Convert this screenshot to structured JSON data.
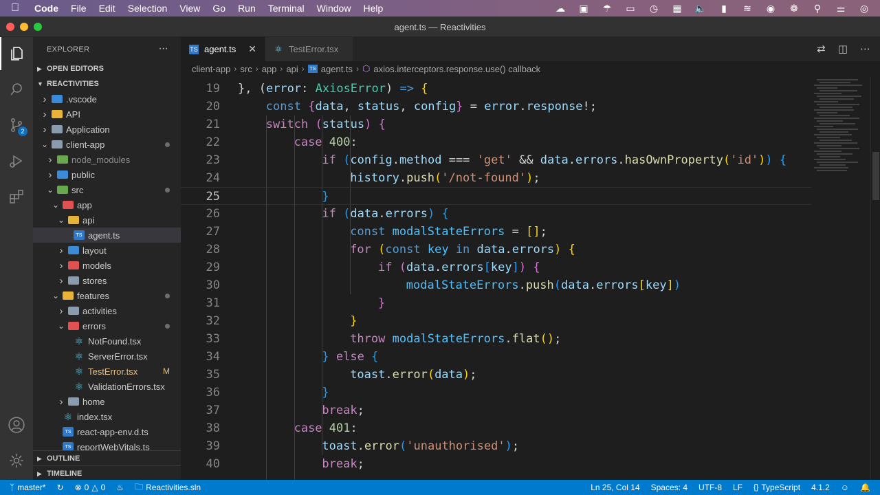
{
  "menubar": {
    "app": "Code",
    "items": [
      "File",
      "Edit",
      "Selection",
      "View",
      "Go",
      "Run",
      "Terminal",
      "Window",
      "Help"
    ]
  },
  "window": {
    "title": "agent.ts — Reactivities"
  },
  "activitybar": {
    "scm_badge": "2"
  },
  "sidebar": {
    "title": "EXPLORER",
    "open_editors": "OPEN EDITORS",
    "project": "REACTIVITIES",
    "tree": [
      {
        "label": ".vscode",
        "depth": 1,
        "kind": "folder",
        "open": false,
        "icon_color": "#3b8bd8"
      },
      {
        "label": "API",
        "depth": 1,
        "kind": "folder",
        "open": false,
        "icon_color": "#e8b339"
      },
      {
        "label": "Application",
        "depth": 1,
        "kind": "folder",
        "open": false,
        "icon_color": "#8a9bb0"
      },
      {
        "label": "client-app",
        "depth": 1,
        "kind": "folder",
        "open": true,
        "icon_color": "#8a9bb0",
        "dot": true
      },
      {
        "label": "node_modules",
        "depth": 2,
        "kind": "folder",
        "open": false,
        "icon_color": "#6aa84f",
        "dim": true
      },
      {
        "label": "public",
        "depth": 2,
        "kind": "folder",
        "open": false,
        "icon_color": "#3b8bd8"
      },
      {
        "label": "src",
        "depth": 2,
        "kind": "folder",
        "open": true,
        "icon_color": "#6aa84f",
        "dot": true
      },
      {
        "label": "app",
        "depth": 3,
        "kind": "folder",
        "open": true,
        "icon_color": "#e05252"
      },
      {
        "label": "api",
        "depth": 4,
        "kind": "folder",
        "open": true,
        "icon_color": "#e8b339"
      },
      {
        "label": "agent.ts",
        "depth": 5,
        "kind": "ts",
        "selected": true
      },
      {
        "label": "layout",
        "depth": 4,
        "kind": "folder",
        "open": false,
        "icon_color": "#3b8bd8"
      },
      {
        "label": "models",
        "depth": 4,
        "kind": "folder",
        "open": false,
        "icon_color": "#e05252"
      },
      {
        "label": "stores",
        "depth": 4,
        "kind": "folder",
        "open": false,
        "icon_color": "#8a9bb0"
      },
      {
        "label": "features",
        "depth": 3,
        "kind": "folder",
        "open": true,
        "icon_color": "#e8b339",
        "dot": true
      },
      {
        "label": "activities",
        "depth": 4,
        "kind": "folder",
        "open": false,
        "icon_color": "#8a9bb0"
      },
      {
        "label": "errors",
        "depth": 4,
        "kind": "folder",
        "open": true,
        "icon_color": "#e05252",
        "dot": true
      },
      {
        "label": "NotFound.tsx",
        "depth": 5,
        "kind": "react"
      },
      {
        "label": "ServerError.tsx",
        "depth": 5,
        "kind": "react"
      },
      {
        "label": "TestError.tsx",
        "depth": 5,
        "kind": "react",
        "modified": "M"
      },
      {
        "label": "ValidationErrors.tsx",
        "depth": 5,
        "kind": "react"
      },
      {
        "label": "home",
        "depth": 4,
        "kind": "folder",
        "open": false,
        "icon_color": "#8a9bb0"
      },
      {
        "label": "index.tsx",
        "depth": 3,
        "kind": "react"
      },
      {
        "label": "react-app-env.d.ts",
        "depth": 3,
        "kind": "ts"
      },
      {
        "label": "reportWebVitals.ts",
        "depth": 3,
        "kind": "ts"
      }
    ],
    "outline": "OUTLINE",
    "timeline": "TIMELINE"
  },
  "tabs": [
    {
      "label": "agent.ts",
      "active": true,
      "kind": "ts"
    },
    {
      "label": "TestError.tsx",
      "active": false,
      "kind": "react"
    }
  ],
  "breadcrumb": [
    "client-app",
    "src",
    "app",
    "api",
    "agent.ts",
    "axios.interceptors.response.use() callback"
  ],
  "editor": {
    "current_line": "25",
    "lines": [
      {
        "n": "19",
        "indent": 0,
        "tokens": [
          [
            "p",
            "}, ("
          ],
          [
            "v",
            "error"
          ],
          [
            "p",
            ": "
          ],
          [
            "t",
            "AxiosError"
          ],
          [
            "p",
            ") "
          ],
          [
            "kb",
            "=>"
          ],
          [
            "p",
            " "
          ],
          [
            "b1",
            "{"
          ]
        ]
      },
      {
        "n": "20",
        "indent": 1,
        "tokens": [
          [
            "kb",
            "const"
          ],
          [
            "p",
            " "
          ],
          [
            "b2",
            "{"
          ],
          [
            "v",
            "data"
          ],
          [
            "p",
            ", "
          ],
          [
            "v",
            "status"
          ],
          [
            "p",
            ", "
          ],
          [
            "v",
            "config"
          ],
          [
            "b2",
            "}"
          ],
          [
            "p",
            " = "
          ],
          [
            "v",
            "error"
          ],
          [
            "p",
            "."
          ],
          [
            "v",
            "response"
          ],
          [
            "p",
            "!;"
          ]
        ]
      },
      {
        "n": "21",
        "indent": 1,
        "tokens": [
          [
            "k",
            "switch"
          ],
          [
            "p",
            " "
          ],
          [
            "b2",
            "("
          ],
          [
            "v",
            "status"
          ],
          [
            "b2",
            ")"
          ],
          [
            "p",
            " "
          ],
          [
            "b2",
            "{"
          ]
        ]
      },
      {
        "n": "22",
        "indent": 2,
        "tokens": [
          [
            "k",
            "case"
          ],
          [
            "p",
            " "
          ],
          [
            "n",
            "400"
          ],
          [
            "p",
            ":"
          ]
        ]
      },
      {
        "n": "23",
        "indent": 3,
        "tokens": [
          [
            "k",
            "if"
          ],
          [
            "p",
            " "
          ],
          [
            "b3",
            "("
          ],
          [
            "v",
            "config"
          ],
          [
            "p",
            "."
          ],
          [
            "v",
            "method"
          ],
          [
            "p",
            " === "
          ],
          [
            "s",
            "'get'"
          ],
          [
            "p",
            " && "
          ],
          [
            "v",
            "data"
          ],
          [
            "p",
            "."
          ],
          [
            "v",
            "errors"
          ],
          [
            "p",
            "."
          ],
          [
            "f",
            "hasOwnProperty"
          ],
          [
            "b1",
            "("
          ],
          [
            "s",
            "'id'"
          ],
          [
            "b1",
            ")"
          ],
          [
            "b3",
            ")"
          ],
          [
            "p",
            " "
          ],
          [
            "b3",
            "{"
          ]
        ]
      },
      {
        "n": "24",
        "indent": 4,
        "tokens": [
          [
            "v",
            "history"
          ],
          [
            "p",
            "."
          ],
          [
            "f",
            "push"
          ],
          [
            "b1",
            "("
          ],
          [
            "s",
            "'/not-found'"
          ],
          [
            "b1",
            ")"
          ],
          [
            "p",
            ";"
          ]
        ]
      },
      {
        "n": "25",
        "indent": 3,
        "tokens": [
          [
            "b3",
            "}"
          ]
        ]
      },
      {
        "n": "26",
        "indent": 3,
        "tokens": [
          [
            "k",
            "if"
          ],
          [
            "p",
            " "
          ],
          [
            "b3",
            "("
          ],
          [
            "v",
            "data"
          ],
          [
            "p",
            "."
          ],
          [
            "v",
            "errors"
          ],
          [
            "b3",
            ")"
          ],
          [
            "p",
            " "
          ],
          [
            "b3",
            "{"
          ]
        ]
      },
      {
        "n": "27",
        "indent": 4,
        "tokens": [
          [
            "kb",
            "const"
          ],
          [
            "p",
            " "
          ],
          [
            "c",
            "modalStateErrors"
          ],
          [
            "p",
            " = "
          ],
          [
            "b1",
            "[]"
          ],
          [
            "p",
            ";"
          ]
        ]
      },
      {
        "n": "28",
        "indent": 4,
        "tokens": [
          [
            "k",
            "for"
          ],
          [
            "p",
            " "
          ],
          [
            "b1",
            "("
          ],
          [
            "kb",
            "const"
          ],
          [
            "p",
            " "
          ],
          [
            "c",
            "key"
          ],
          [
            "p",
            " "
          ],
          [
            "kb",
            "in"
          ],
          [
            "p",
            " "
          ],
          [
            "v",
            "data"
          ],
          [
            "p",
            "."
          ],
          [
            "v",
            "errors"
          ],
          [
            "b1",
            ")"
          ],
          [
            "p",
            " "
          ],
          [
            "b1",
            "{"
          ]
        ]
      },
      {
        "n": "29",
        "indent": 5,
        "tokens": [
          [
            "k",
            "if"
          ],
          [
            "p",
            " "
          ],
          [
            "b2",
            "("
          ],
          [
            "v",
            "data"
          ],
          [
            "p",
            "."
          ],
          [
            "v",
            "errors"
          ],
          [
            "b3",
            "["
          ],
          [
            "v",
            "key"
          ],
          [
            "b3",
            "]"
          ],
          [
            "b2",
            ")"
          ],
          [
            "p",
            " "
          ],
          [
            "b2",
            "{"
          ]
        ]
      },
      {
        "n": "30",
        "indent": 6,
        "tokens": [
          [
            "c",
            "modalStateErrors"
          ],
          [
            "p",
            "."
          ],
          [
            "f",
            "push"
          ],
          [
            "b3",
            "("
          ],
          [
            "v",
            "data"
          ],
          [
            "p",
            "."
          ],
          [
            "v",
            "errors"
          ],
          [
            "b1",
            "["
          ],
          [
            "v",
            "key"
          ],
          [
            "b1",
            "]"
          ],
          [
            "b3",
            ")"
          ]
        ]
      },
      {
        "n": "31",
        "indent": 5,
        "tokens": [
          [
            "b2",
            "}"
          ]
        ]
      },
      {
        "n": "32",
        "indent": 4,
        "tokens": [
          [
            "b1",
            "}"
          ]
        ]
      },
      {
        "n": "33",
        "indent": 4,
        "tokens": [
          [
            "k",
            "throw"
          ],
          [
            "p",
            " "
          ],
          [
            "c",
            "modalStateErrors"
          ],
          [
            "p",
            "."
          ],
          [
            "f",
            "flat"
          ],
          [
            "b1",
            "()"
          ],
          [
            "p",
            ";"
          ]
        ]
      },
      {
        "n": "34",
        "indent": 3,
        "tokens": [
          [
            "b3",
            "}"
          ],
          [
            "p",
            " "
          ],
          [
            "k",
            "else"
          ],
          [
            "p",
            " "
          ],
          [
            "b3",
            "{"
          ]
        ]
      },
      {
        "n": "35",
        "indent": 4,
        "tokens": [
          [
            "v",
            "toast"
          ],
          [
            "p",
            "."
          ],
          [
            "f",
            "error"
          ],
          [
            "b1",
            "("
          ],
          [
            "v",
            "data"
          ],
          [
            "b1",
            ")"
          ],
          [
            "p",
            ";"
          ]
        ]
      },
      {
        "n": "36",
        "indent": 3,
        "tokens": [
          [
            "b3",
            "}"
          ]
        ]
      },
      {
        "n": "37",
        "indent": 3,
        "tokens": [
          [
            "k",
            "break"
          ],
          [
            "p",
            ";"
          ]
        ]
      },
      {
        "n": "38",
        "indent": 2,
        "tokens": [
          [
            "k",
            "case"
          ],
          [
            "p",
            " "
          ],
          [
            "n",
            "401"
          ],
          [
            "p",
            ":"
          ]
        ]
      },
      {
        "n": "39",
        "indent": 3,
        "tokens": [
          [
            "v",
            "toast"
          ],
          [
            "p",
            "."
          ],
          [
            "f",
            "error"
          ],
          [
            "b3",
            "("
          ],
          [
            "s",
            "'unauthorised'"
          ],
          [
            "b3",
            ")"
          ],
          [
            "p",
            ";"
          ]
        ]
      },
      {
        "n": "40",
        "indent": 3,
        "tokens": [
          [
            "k",
            "break"
          ],
          [
            "p",
            ";"
          ]
        ]
      }
    ]
  },
  "statusbar": {
    "branch": "master*",
    "errors": "0",
    "warnings": "0",
    "solution": "Reactivities.sln",
    "position": "Ln 25, Col 14",
    "spaces": "Spaces: 4",
    "encoding": "UTF-8",
    "eol": "LF",
    "language": "TypeScript",
    "version": "4.1.2"
  }
}
